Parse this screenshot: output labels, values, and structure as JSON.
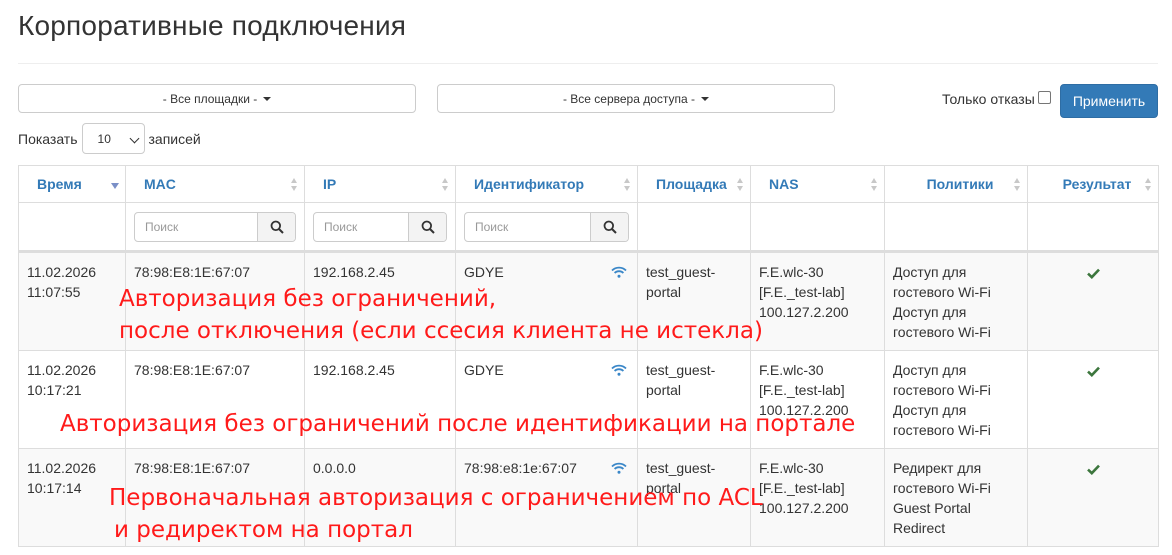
{
  "page": {
    "title": "Корпоративные подключения"
  },
  "filters": {
    "sites_label": "- Все площадки -",
    "servers_label": "- Все сервера доступа -",
    "only_rejects_label": "Только отказы",
    "apply_label": "Применить",
    "show_label": "Показать",
    "page_size": "10",
    "records_label": "записей"
  },
  "table": {
    "columns": [
      "Время",
      "MAC",
      "IP",
      "Идентификатор",
      "Площадка",
      "NAS",
      "Политики",
      "Результат"
    ],
    "search_placeholder": "Поиск",
    "rows": [
      {
        "date": "11.02.2026",
        "time": "11:07:55",
        "mac": "78:98:E8:1E:67:07",
        "ip": "192.168.2.45",
        "identifier": "GDYE",
        "site_1": "test_guest-",
        "site_2": "portal",
        "nas_1": "F.E.wlc-30",
        "nas_2": "[F.E._test-lab]",
        "nas_3": "100.127.2.200",
        "policy_1": "Доступ для",
        "policy_2": "гостевого Wi-Fi",
        "policy_3": "Доступ для",
        "policy_4": "гостевого Wi-Fi",
        "result": "success"
      },
      {
        "date": "11.02.2026",
        "time": "10:17:21",
        "mac": "78:98:E8:1E:67:07",
        "ip": "192.168.2.45",
        "identifier": "GDYE",
        "site_1": "test_guest-",
        "site_2": "portal",
        "nas_1": "F.E.wlc-30",
        "nas_2": "[F.E._test-lab]",
        "nas_3": "100.127.2.200",
        "policy_1": "Доступ для",
        "policy_2": "гостевого Wi-Fi",
        "policy_3": "Доступ для",
        "policy_4": "гостевого Wi-Fi",
        "result": "success"
      },
      {
        "date": "11.02.2026",
        "time": "10:17:14",
        "mac": "78:98:E8:1E:67:07",
        "ip": "0.0.0.0",
        "identifier": "78:98:e8:1e:67:07",
        "site_1": "test_guest-",
        "site_2": "portal",
        "nas_1": "F.E.wlc-30",
        "nas_2": "[F.E._test-lab]",
        "nas_3": "100.127.2.200",
        "policy_1": "Редирект для",
        "policy_2": "гостевого Wi-Fi",
        "policy_3": "Guest Portal",
        "policy_4": "Redirect",
        "result": "success"
      }
    ]
  },
  "annotations": {
    "a1_line1": "Авторизация без ограничений,",
    "a1_line2": "после отключения (если ссесия клиента не истекла)",
    "a2": "Авторизация без ограничений после идентификации на портале",
    "a3_line1": "Первоначальная авторизация с ограничением по ACL",
    "a3_line2": "и редиректом на портал"
  },
  "colors": {
    "link": "#337ab7",
    "primary": "#337ab7",
    "success": "#3c763d",
    "wifi": "#3a87c8",
    "annotation": "#ff1a1a"
  },
  "icons": {
    "search": "search-icon",
    "wifi": "wifi-icon",
    "success": "check-icon"
  }
}
